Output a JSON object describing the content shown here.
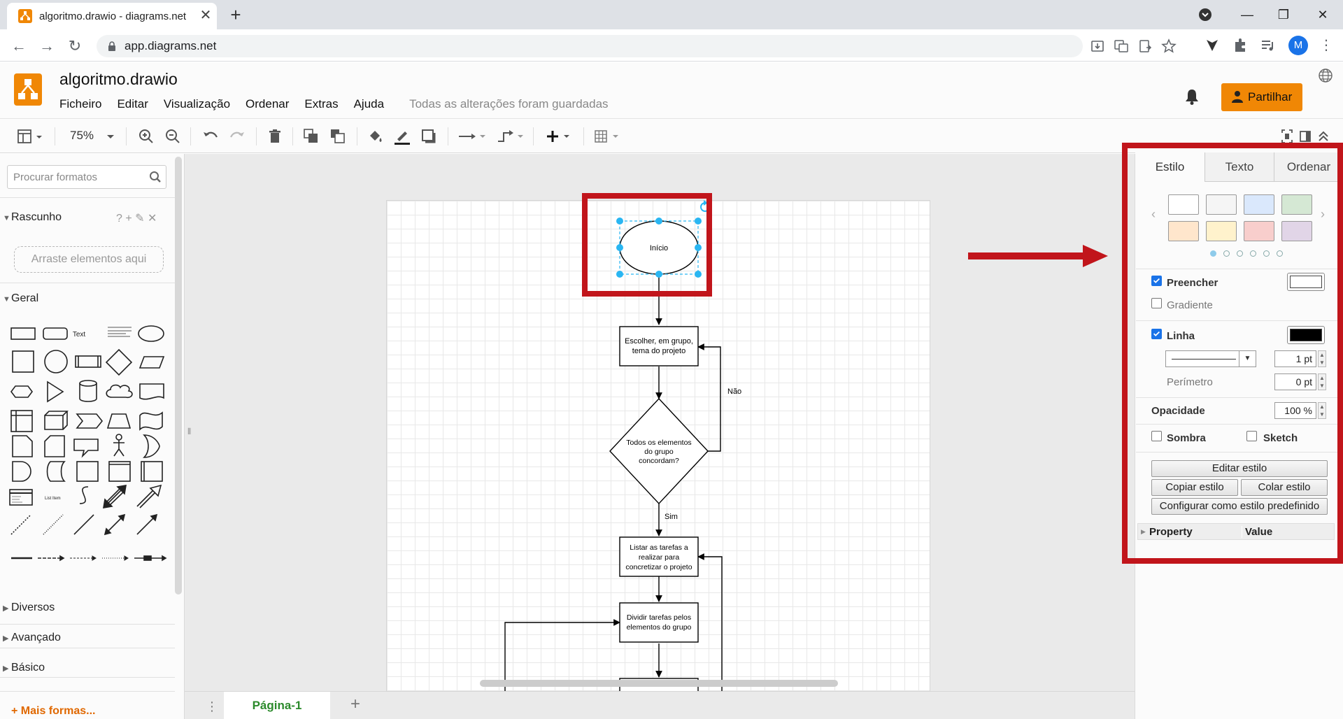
{
  "browser": {
    "tab_title": "algoritmo.drawio - diagrams.net",
    "url": "app.diagrams.net",
    "profile_initial": "M",
    "new_tab_symbol": "+",
    "close_symbol": "✕",
    "minimize_symbol": "—",
    "maximize_symbol": "❐",
    "window_close_symbol": "✕"
  },
  "app": {
    "doc_title": "algoritmo.drawio",
    "menu": [
      "Ficheiro",
      "Editar",
      "Visualização",
      "Ordenar",
      "Extras",
      "Ajuda"
    ],
    "save_status": "Todas as alterações foram guardadas",
    "share_label": "Partilhar",
    "brand_color": "#f08705"
  },
  "toolbar": {
    "zoom": "75%"
  },
  "sidebar": {
    "search_placeholder": "Procurar formatos",
    "scratchpad_title": "Rascunho",
    "scratchpad_tools": "? + ✎ ✕",
    "drop_zone": "Arraste elementos aqui",
    "general_title": "Geral",
    "shape_text": "Text",
    "shape_listitem": "List Item",
    "sections": [
      "Diversos",
      "Avançado",
      "Básico"
    ],
    "more_shapes": "+ Mais formas..."
  },
  "diagram": {
    "start": "Início",
    "step1": [
      "Escolher, em grupo,",
      "tema do projeto"
    ],
    "decision": [
      "Todos os elementos",
      "do grupo",
      "concordam?"
    ],
    "no_label": "Não",
    "yes_label": "Sim",
    "step2": [
      "Listar as tarefas a",
      "realizar para",
      "concretizar o projeto"
    ],
    "step3": [
      "Dividir tarefas pelos",
      "elementos do grupo"
    ]
  },
  "pages": {
    "tab": "Página-1",
    "add_symbol": "+",
    "menu_symbol": "⋮"
  },
  "format_panel": {
    "tabs": [
      "Estilo",
      "Texto",
      "Ordenar"
    ],
    "swatches": [
      "#ffffff",
      "#f5f5f5",
      "#dae8fc",
      "#d5e8d4",
      "#ffe6cc",
      "#fff2cc",
      "#f8cecc",
      "#e1d5e7"
    ],
    "fill_label": "Preencher",
    "gradient_label": "Gradiente",
    "line_label": "Linha",
    "line_width": "1 pt",
    "perimeter_label": "Perímetro",
    "perimeter_value": "0 pt",
    "opacity_label": "Opacidade",
    "opacity_value": "100 %",
    "shadow_label": "Sombra",
    "sketch_label": "Sketch",
    "edit_style": "Editar estilo",
    "copy_style": "Copiar estilo",
    "paste_style": "Colar estilo",
    "set_default": "Configurar como estilo predefinido",
    "prop_col": "Property",
    "value_col": "Value",
    "fill_on": true,
    "line_on": true
  },
  "annotation_color": "#c1151b"
}
